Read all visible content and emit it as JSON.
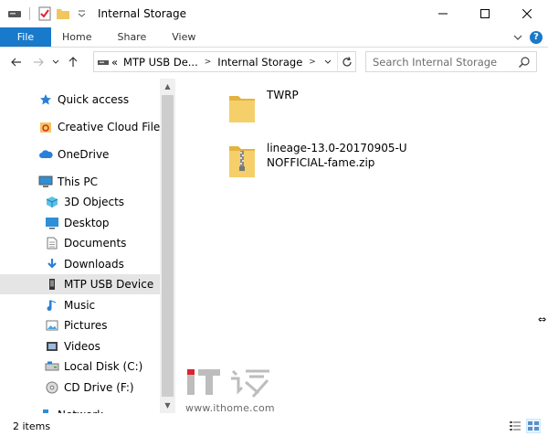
{
  "window": {
    "title": "Internal Storage",
    "minimize_label": "—",
    "maximize_label": "☐",
    "close_label": "✕"
  },
  "ribbon": {
    "file_label": "File",
    "tabs": [
      "Home",
      "Share",
      "View"
    ]
  },
  "address": {
    "overflow_label": "«",
    "segments": [
      "MTP USB De...",
      "Internal Storage"
    ],
    "search_placeholder": "Search Internal Storage"
  },
  "nav": {
    "items": [
      {
        "label": "Quick access",
        "icon": "star-icon",
        "indent": 0,
        "selected": false
      },
      {
        "label": "Creative Cloud Files",
        "icon": "creative-cloud-icon",
        "indent": 0,
        "selected": false
      },
      {
        "label": "OneDrive",
        "icon": "cloud-icon",
        "indent": 0,
        "selected": false
      },
      {
        "label": "This PC",
        "icon": "computer-icon",
        "indent": 0,
        "selected": false
      },
      {
        "label": "3D Objects",
        "icon": "cube-icon",
        "indent": 1,
        "selected": false
      },
      {
        "label": "Desktop",
        "icon": "desktop-icon",
        "indent": 1,
        "selected": false
      },
      {
        "label": "Documents",
        "icon": "document-icon",
        "indent": 1,
        "selected": false
      },
      {
        "label": "Downloads",
        "icon": "download-icon",
        "indent": 1,
        "selected": false
      },
      {
        "label": "MTP USB Device",
        "icon": "phone-icon",
        "indent": 1,
        "selected": true
      },
      {
        "label": "Music",
        "icon": "music-icon",
        "indent": 1,
        "selected": false
      },
      {
        "label": "Pictures",
        "icon": "picture-icon",
        "indent": 1,
        "selected": false
      },
      {
        "label": "Videos",
        "icon": "video-icon",
        "indent": 1,
        "selected": false
      },
      {
        "label": "Local Disk (C:)",
        "icon": "disk-icon",
        "indent": 1,
        "selected": false
      },
      {
        "label": "CD Drive (F:)",
        "icon": "cd-icon",
        "indent": 1,
        "selected": false
      },
      {
        "label": "Network",
        "icon": "network-icon",
        "indent": 0,
        "selected": false
      }
    ]
  },
  "files": [
    {
      "name": "TWRP",
      "type": "folder",
      "icon": "folder-icon"
    },
    {
      "name": "lineage-13.0-20170905-UNOFFICIAL-fame.zip",
      "type": "zip",
      "icon": "zip-folder-icon"
    }
  ],
  "watermark": {
    "url": "www.ithome.com"
  },
  "status": {
    "item_count": "2 items"
  },
  "colors": {
    "accent": "#1979ca",
    "folder": "#f0c75e",
    "selected_bg": "#e5e5e5"
  }
}
